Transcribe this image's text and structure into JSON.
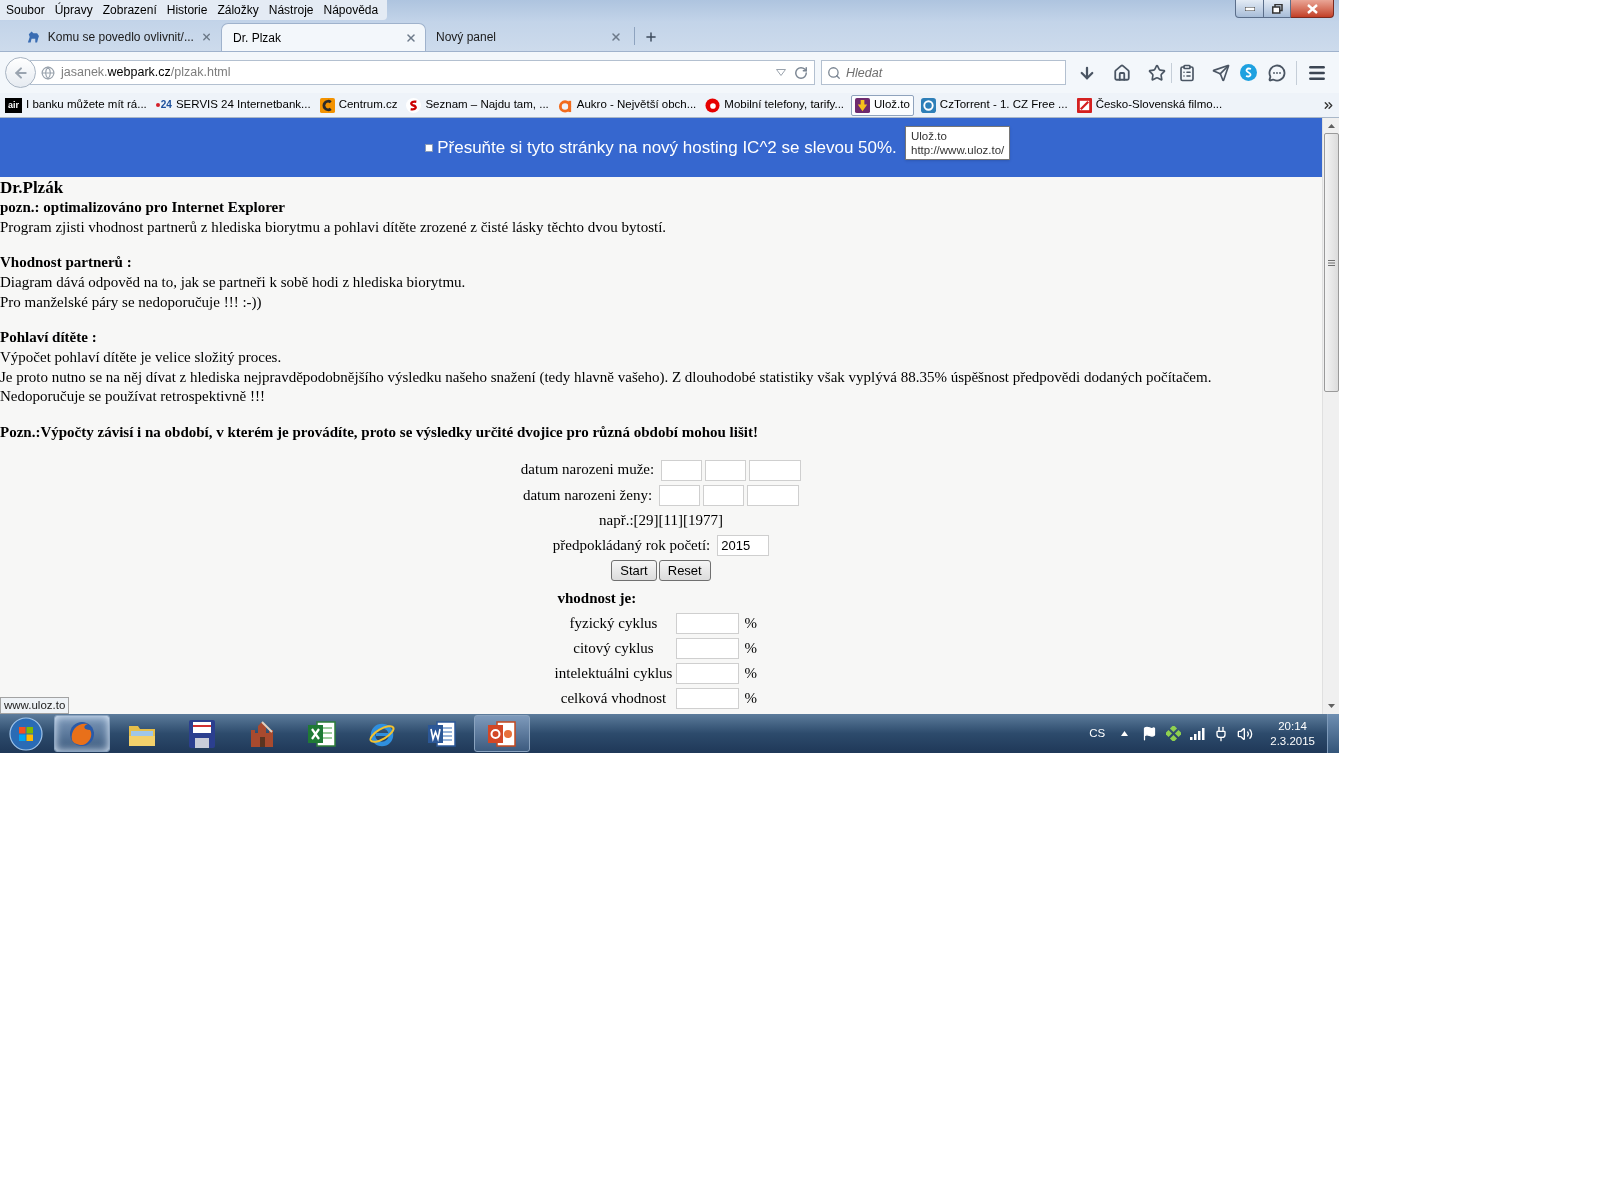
{
  "menu_bar": {
    "items": [
      "Soubor",
      "Úpravy",
      "Zobrazení",
      "Historie",
      "Záložky",
      "Nástroje",
      "Nápověda"
    ]
  },
  "tabs": [
    {
      "title": "Komu se povedlo ovlivnit/...",
      "selected": false
    },
    {
      "title": "Dr. Plzak",
      "selected": true
    },
    {
      "title": "Nový panel",
      "selected": false
    }
  ],
  "address_bar": {
    "url": [
      {
        "text": "jasanek.",
        "highlighted": false
      },
      {
        "text": "webpark.cz",
        "highlighted": true
      },
      {
        "text": "/plzak.html",
        "highlighted": false
      }
    ]
  },
  "search_field": {
    "placeholder": "Hledat"
  },
  "bookmarks": [
    {
      "label": "I banku můžete mít rá...",
      "icon_text": "air",
      "hovered": false
    },
    {
      "label": "SERVIS 24 Internetbank...",
      "icon_text": "24",
      "hovered": false
    },
    {
      "label": "Centrum.cz",
      "hovered": false
    },
    {
      "label": "Seznam – Najdu tam, ...",
      "hovered": false
    },
    {
      "label": "Aukro - Největší obch...",
      "hovered": false
    },
    {
      "label": "Mobilní telefony, tarify...",
      "hovered": false
    },
    {
      "label": "Ulož.to",
      "hovered": true
    },
    {
      "label": "CzTorrent - 1. CZ Free ...",
      "hovered": false
    },
    {
      "label": "Česko-Slovenská filmo...",
      "hovered": false
    }
  ],
  "banner": {
    "text": "Přesuňte si tyto stránky na nový hosting IC^2 se slevou 50%."
  },
  "tooltip": {
    "title": "Ulož.to",
    "url": "http://www.uloz.to/"
  },
  "page": {
    "title": "Dr.Plzák",
    "note": "pozn.: optimalizováno pro Internet Explorer",
    "intro": "Program zjisti vhodnost partnerů z hlediska biorytmu a pohlavi dítěte zrozené z čisté lásky těchto dvou bytostí.",
    "sections": [
      {
        "heading": "Vhodnost partnerů :",
        "lines": [
          "Diagram dává odpověd na to, jak se partneři k sobě hodi z hlediska biorytmu.",
          "Pro manželské páry se nedoporučuje !!! :-))"
        ]
      },
      {
        "heading": "Pohlaví dítěte :",
        "lines": [
          "Výpočet pohlaví dítěte je velice složitý proces.",
          "Je proto nutno se na něj dívat z hlediska nejpravděpodobnějšího výsledku našeho snažení (tedy hlavně vašeho). Z dlouhodobé statistiky však vyplývá 88.35% úspěšnost předpovědi dodaných počítačem.",
          "Nedoporučuje se používat retrospektivně !!!"
        ]
      }
    ],
    "warning": "Pozn.:Výpočty závisí i na období, v kterém je provádíte, proto se výsledky určité dvojice pro různá období mohou lišit!"
  },
  "form": {
    "date_rows": [
      {
        "label": "datum narozeni muže:",
        "inputs": [
          {
            "kind": "day"
          },
          {
            "kind": "month"
          },
          {
            "kind": "year"
          }
        ]
      },
      {
        "label": "datum narozeni ženy:",
        "inputs": [
          {
            "kind": "day"
          },
          {
            "kind": "month"
          },
          {
            "kind": "year"
          }
        ]
      }
    ],
    "example": "např.:[29][11][1977]",
    "year_field": {
      "label": "předpokládaný rok početí:",
      "value": "2015"
    },
    "buttons": [
      "Start",
      "Reset"
    ],
    "results": {
      "heading": "vhodnost je:",
      "rows": [
        {
          "label": "fyzický cyklus",
          "unit": "%"
        },
        {
          "label": "citový cyklus",
          "unit": "%"
        },
        {
          "label": "intelektuálni cyklus",
          "unit": "%"
        },
        {
          "label": "celková vhodnost",
          "unit": "%"
        }
      ]
    }
  },
  "status_link": "www.uloz.to",
  "taskbar": {
    "apps": [
      {
        "running": true,
        "active": true
      },
      {
        "running": false,
        "active": false
      },
      {
        "running": false,
        "active": false
      },
      {
        "running": false,
        "active": false
      },
      {
        "running": false,
        "active": false
      },
      {
        "running": false,
        "active": false
      },
      {
        "running": false,
        "active": false
      },
      {
        "running": true,
        "active": false
      }
    ],
    "language": "CS",
    "time": "20:14",
    "date": "2.3.2015"
  }
}
